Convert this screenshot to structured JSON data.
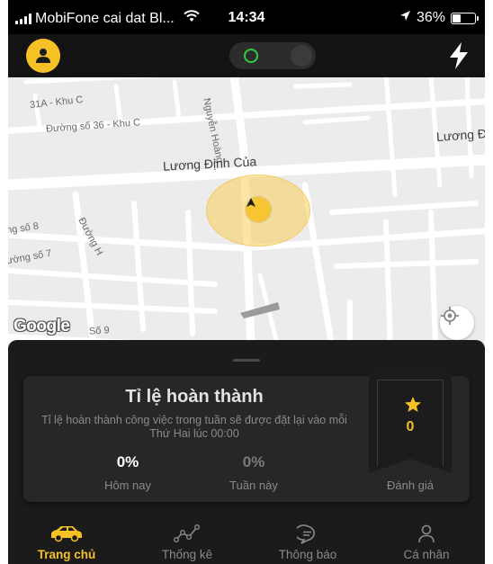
{
  "status_bar": {
    "carrier": "MobiFone cai dat Bl...",
    "time": "14:34",
    "battery": "36%",
    "battery_level": 0.36,
    "icons": [
      "signal-icon",
      "wifi-icon",
      "location-arrow-icon",
      "battery-icon"
    ]
  },
  "header": {
    "avatar_icon": "user-avatar-icon",
    "toggle_state": "off",
    "action_icon": "lightning-bolt-icon"
  },
  "map": {
    "labels": {
      "khu_c": "31A - Khu C",
      "duong36": "Đường số 36 - Khu C",
      "nguyen_hoang": "Nguyễn Hoàng",
      "luong_di": "Lương Đì",
      "luong_dinh_cua": "Lương Định Của",
      "so8": "ng số 8",
      "duong_h": "Đường H",
      "so7": "ường số 7",
      "so9": "Số 9"
    },
    "logo": "Google",
    "locate_icon": "crosshair-icon",
    "marker_icon": "navigation-arrow-icon"
  },
  "completion": {
    "title": "Tỉ lệ hoàn thành",
    "description": "Tỉ lệ hoàn thành công việc trong tuần sẽ được đặt lại vào mỗi Thứ Hai lúc 00:00",
    "today_value": "0%",
    "today_label": "Hôm nay",
    "week_value": "0%",
    "week_label": "Tuần này",
    "rating_value": "0",
    "rating_label": "Đánh giá"
  },
  "tabs": [
    {
      "label": "Trang chủ",
      "icon": "car-icon",
      "active": true
    },
    {
      "label": "Thống kê",
      "icon": "stats-line-icon",
      "active": false
    },
    {
      "label": "Thông báo",
      "icon": "chat-bubble-icon",
      "active": false
    },
    {
      "label": "Cá nhân",
      "icon": "person-icon",
      "active": false
    }
  ],
  "colors": {
    "accent": "#f5c226",
    "background": "#1b1b1b",
    "card": "#272727",
    "toggle_ring": "#2ecc40"
  }
}
